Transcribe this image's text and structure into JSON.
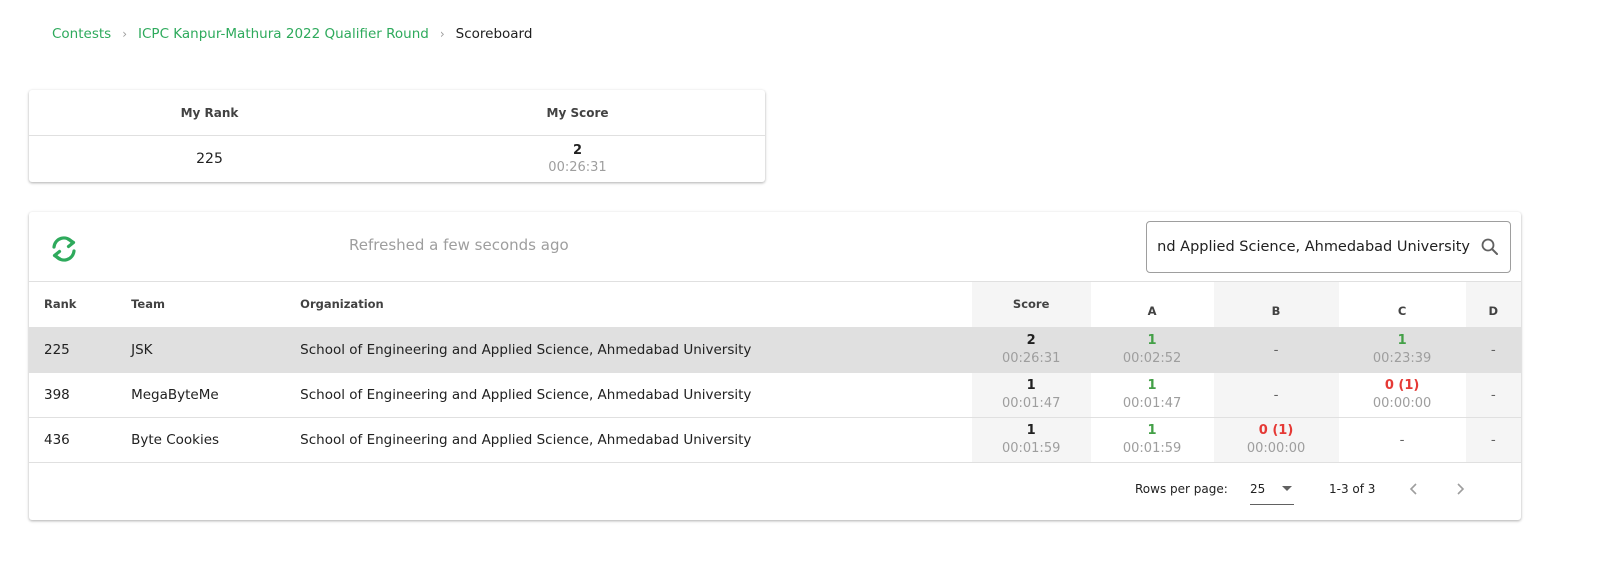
{
  "breadcrumb": {
    "items": [
      "Contests",
      "ICPC Kanpur-Mathura 2022 Qualifier Round"
    ],
    "current": "Scoreboard",
    "separator": "›"
  },
  "summary": {
    "rank_label": "My Rank",
    "score_label": "My Score",
    "rank": "225",
    "score": "2",
    "time": "00:26:31"
  },
  "toolbar": {
    "refresh_icon": "refresh-icon",
    "refreshed_text": "Refreshed a few seconds ago",
    "search_value": "School of Engineering and Applied Science, Ahmedabad University",
    "search_icon": "search-icon"
  },
  "table": {
    "columns": {
      "rank": "Rank",
      "team": "Team",
      "organization": "Organization",
      "score": "Score",
      "a": "A",
      "b": "B",
      "c": "C",
      "d": "D"
    },
    "rows": [
      {
        "rank": "225",
        "team": "JSK",
        "organization": "School of Engineering and Applied Science, Ahmedabad University",
        "score": "2",
        "time": "00:26:31",
        "a": {
          "top": "1",
          "bot": "00:02:52"
        },
        "b": {
          "top": "-",
          "bot": ""
        },
        "c": {
          "top": "1",
          "bot": "00:23:39"
        },
        "d": {
          "top": "-",
          "bot": ""
        }
      },
      {
        "rank": "398",
        "team": "MegaByteMe",
        "organization": "School of Engineering and Applied Science, Ahmedabad University",
        "score": "1",
        "time": "00:01:47",
        "a": {
          "top": "1",
          "bot": "00:01:47"
        },
        "b": {
          "top": "-",
          "bot": ""
        },
        "c": {
          "top": "0 (1)",
          "bot": "00:00:00"
        },
        "d": {
          "top": "-",
          "bot": ""
        }
      },
      {
        "rank": "436",
        "team": "Byte Cookies",
        "organization": "School of Engineering and Applied Science, Ahmedabad University",
        "score": "1",
        "time": "00:01:59",
        "a": {
          "top": "1",
          "bot": "00:01:59"
        },
        "b": {
          "top": "0 (1)",
          "bot": "00:00:00"
        },
        "c": {
          "top": "-",
          "bot": ""
        },
        "d": {
          "top": "-",
          "bot": ""
        }
      }
    ]
  },
  "pagination": {
    "rows_per_page_label": "Rows per page:",
    "rows_per_page": "25",
    "range": "1-3 of 3"
  },
  "colors": {
    "accent": "#2eaa5c",
    "accepted": "#43a047",
    "rejected": "#e53935",
    "highlight_row": "#e0e0e0"
  }
}
